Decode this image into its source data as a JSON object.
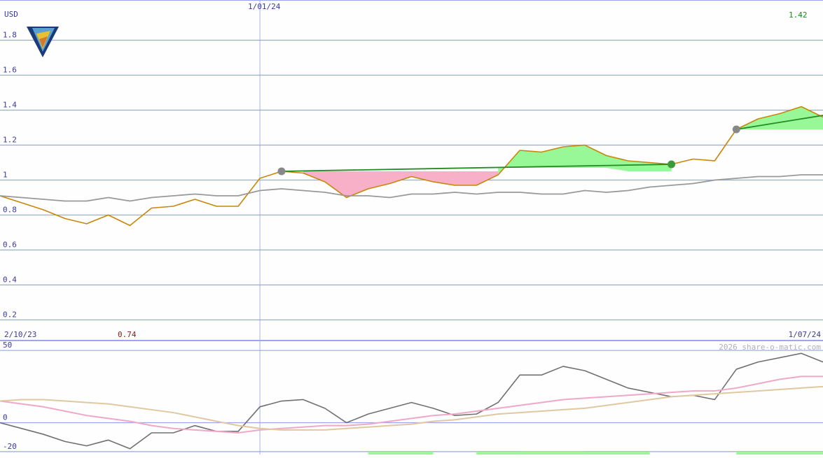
{
  "header": {
    "currency": "USD",
    "date_marker": "1/01/24",
    "last_value": "1.42"
  },
  "footer": {
    "start_date": "2/10/23",
    "min_value": "0.74",
    "end_date": "1/07/24",
    "copyright": "2026 share-o-matic.com"
  },
  "colors": {
    "price": "#c8860a",
    "comparison": "#999999",
    "trend": "#228b22",
    "gain_fill": "#98f898",
    "loss_fill": "#f8b0c8",
    "grid": "#9aa6ee",
    "axis_text": "#3a3aa0",
    "last_value_text": "#1a8a1a",
    "min_value_text": "#8b1a1a",
    "oscillator": "#707070",
    "signal_pink": "#f0a8c8",
    "signal_tan": "#e0c8a0",
    "histogram": "#98f898"
  },
  "chart_data": [
    {
      "type": "line",
      "panel": "price",
      "ylabel": "USD",
      "ylim": [
        0.15,
        1.95
      ],
      "yticks": [
        "1.8",
        "1.6",
        "1.4",
        "1.2",
        "1",
        "0.8",
        "0.6",
        "0.4",
        "0.2"
      ],
      "ytick_values": [
        1.8,
        1.6,
        1.4,
        1.2,
        1.0,
        0.8,
        0.6,
        0.4,
        0.2
      ],
      "x": [
        0,
        2,
        4,
        6,
        8,
        10,
        12,
        14,
        16,
        18,
        20,
        22,
        24,
        26,
        28,
        30,
        32,
        34,
        36,
        38,
        40,
        42,
        44,
        46,
        48,
        50,
        52,
        54,
        56,
        58,
        60,
        62,
        64,
        66,
        68,
        70,
        72,
        74,
        76
      ],
      "xlim": [
        0,
        76
      ],
      "x_marker": 24,
      "series": [
        {
          "role": "price",
          "values": [
            0.91,
            0.87,
            0.83,
            0.78,
            0.75,
            0.8,
            0.74,
            0.84,
            0.85,
            0.89,
            0.85,
            0.85,
            1.01,
            1.05,
            1.04,
            0.99,
            0.9,
            0.95,
            0.98,
            1.02,
            0.99,
            0.97,
            0.97,
            1.03,
            1.17,
            1.16,
            1.19,
            1.2,
            1.14,
            1.11,
            1.1,
            1.09,
            1.12,
            1.11,
            1.29,
            1.35,
            1.38,
            1.42,
            1.36
          ]
        },
        {
          "role": "comparison",
          "values": [
            0.91,
            0.9,
            0.89,
            0.88,
            0.88,
            0.9,
            0.88,
            0.9,
            0.91,
            0.92,
            0.91,
            0.91,
            0.94,
            0.95,
            0.94,
            0.93,
            0.91,
            0.91,
            0.9,
            0.92,
            0.92,
            0.93,
            0.92,
            0.93,
            0.93,
            0.92,
            0.92,
            0.94,
            0.93,
            0.94,
            0.96,
            0.97,
            0.98,
            1.0,
            1.01,
            1.02,
            1.02,
            1.03,
            1.03
          ]
        }
      ],
      "trend_segments": [
        {
          "x": [
            26,
            62
          ],
          "y": [
            1.05,
            1.09
          ]
        },
        {
          "x": [
            68,
            76
          ],
          "y": [
            1.29,
            1.37
          ]
        }
      ],
      "markers": [
        {
          "x": 26,
          "y": 1.05,
          "color": "#888888"
        },
        {
          "x": 62,
          "y": 1.09,
          "color": "#3a9a3a"
        },
        {
          "x": 68,
          "y": 1.29,
          "color": "#888888"
        }
      ],
      "fill_bands": [
        {
          "polarity": "loss",
          "x": [
            28,
            30,
            32,
            34,
            36,
            38,
            40,
            42,
            44,
            46
          ],
          "upper": [
            1.05,
            1.05,
            1.05,
            1.05,
            1.05,
            1.05,
            1.05,
            1.05,
            1.05,
            1.05
          ],
          "lower": [
            1.04,
            0.99,
            0.9,
            0.95,
            0.98,
            1.02,
            0.99,
            0.97,
            0.97,
            1.03
          ]
        },
        {
          "polarity": "gain",
          "x": [
            46,
            48,
            50,
            52,
            54,
            56,
            58,
            60,
            62
          ],
          "upper": [
            1.03,
            1.17,
            1.16,
            1.19,
            1.2,
            1.14,
            1.11,
            1.1,
            1.09
          ],
          "lower": [
            1.07,
            1.07,
            1.07,
            1.07,
            1.07,
            1.07,
            1.05,
            1.05,
            1.05
          ]
        },
        {
          "polarity": "gain",
          "x": [
            68,
            70,
            72,
            74,
            76
          ],
          "upper": [
            1.29,
            1.35,
            1.38,
            1.42,
            1.36
          ],
          "lower": [
            1.29,
            1.29,
            1.29,
            1.29,
            1.29
          ]
        }
      ]
    },
    {
      "type": "line",
      "panel": "oscillator",
      "ylim": [
        -22,
        53
      ],
      "yticks": [
        "50",
        "0",
        "-20"
      ],
      "ytick_values": [
        50,
        0,
        -20
      ],
      "x": [
        0,
        2,
        4,
        6,
        8,
        10,
        12,
        14,
        16,
        18,
        20,
        22,
        24,
        26,
        28,
        30,
        32,
        34,
        36,
        38,
        40,
        42,
        44,
        46,
        48,
        50,
        52,
        54,
        56,
        58,
        60,
        62,
        64,
        66,
        68,
        70,
        72,
        74,
        76
      ],
      "xlim": [
        0,
        76
      ],
      "series": [
        {
          "role": "oscillator",
          "values": [
            0,
            -4,
            -8,
            -13,
            -16,
            -12,
            -18,
            -7,
            -7,
            -2,
            -6,
            -6,
            11,
            15,
            16,
            10,
            0,
            6,
            10,
            14,
            10,
            5,
            6,
            14,
            33,
            33,
            39,
            36,
            30,
            24,
            21,
            18,
            19,
            16,
            37,
            42,
            45,
            48,
            42
          ]
        },
        {
          "role": "signal-pink",
          "values": [
            15,
            13,
            11,
            8,
            5,
            3,
            1,
            -2,
            -4,
            -5,
            -6,
            -7,
            -5,
            -4,
            -3,
            -2,
            -2,
            -1,
            1,
            3,
            5,
            6,
            8,
            10,
            12,
            14,
            16,
            17,
            18,
            19,
            20,
            21,
            22,
            22,
            24,
            27,
            30,
            32,
            32
          ]
        },
        {
          "role": "signal-tan",
          "values": [
            15,
            16,
            16,
            15,
            14,
            13,
            11,
            9,
            7,
            4,
            1,
            -2,
            -4,
            -5,
            -5,
            -5,
            -4,
            -3,
            -2,
            -1,
            1,
            2,
            4,
            6,
            7,
            8,
            9,
            10,
            12,
            14,
            16,
            18,
            19,
            20,
            21,
            22,
            23,
            24,
            25
          ]
        }
      ],
      "histogram_bars": [
        {
          "x0": 34,
          "x1": 40,
          "value": 1
        },
        {
          "x0": 44,
          "x1": 48,
          "value": 1
        },
        {
          "x0": 48,
          "x1": 54,
          "value": 2
        },
        {
          "x0": 54,
          "x1": 60,
          "value": 1
        },
        {
          "x0": 68,
          "x1": 76,
          "value": 1
        }
      ]
    }
  ]
}
